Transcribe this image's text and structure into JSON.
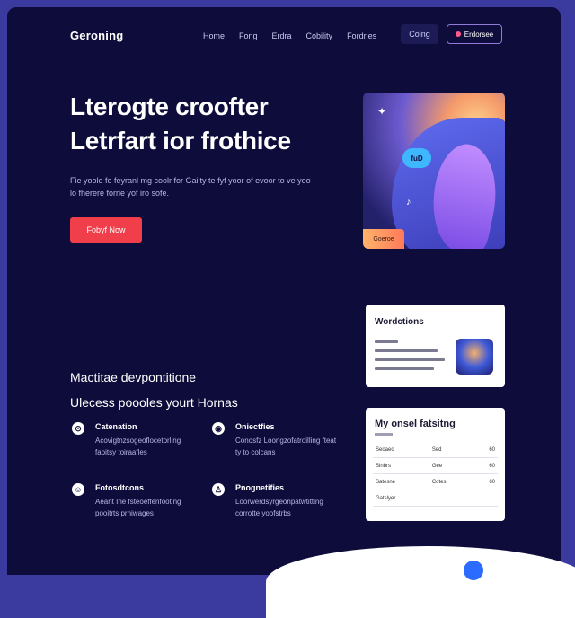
{
  "nav": {
    "logo": "Geroning",
    "links": [
      "Home",
      "Fong",
      "Erdra",
      "Cobility",
      "Fordrles"
    ],
    "ghost_button": "Colng",
    "outline_button": "Erdorsee"
  },
  "hero": {
    "title_line1": "Lterogte croofter",
    "title_line2": "Letrfart ior frothice",
    "description": "Fie yoole fe feyranl mg coolr for Gailty te fyf yoor of evoor to ve yoo lo fherere forrie yof iro sofe.",
    "cta": "Fobyf Now",
    "art": {
      "chip": "fuD",
      "tag": "Goeroe"
    }
  },
  "section": {
    "title_line1": "Mactitae devpontitione",
    "title_line2": "Ulecess poooles yourt Hornas"
  },
  "features": [
    {
      "icon": "clock-icon",
      "glyph": "⊙",
      "title": "Catenation",
      "desc": "Acovigtnzsogeoflocetorling faoitsy toiraafles"
    },
    {
      "icon": "target-icon",
      "glyph": "◉",
      "title": "Oniectfies",
      "desc": "Conosfz Loongzofatroilling fteat ty to colcans"
    },
    {
      "icon": "face-icon",
      "glyph": "☺",
      "title": "Fotosdtcons",
      "desc": "Aeant Ine fsteoeffenfooting pooitrts prniwages"
    },
    {
      "icon": "person-icon",
      "glyph": "♙",
      "title": "Pnognetifies",
      "desc": "Loorwerdsyrgeonpatwtitting corrotte yoofstrbs"
    }
  ],
  "cards": {
    "card1_title": "Wordctions",
    "card2_title": "My onsel fatsitng",
    "table_rows": [
      [
        "Seoaeo",
        "Sed",
        "60"
      ],
      [
        "Sinbrs",
        "Gee",
        "60"
      ],
      [
        "Satesne",
        "Cotes",
        "60"
      ],
      [
        "Gatslyer",
        "",
        ""
      ]
    ]
  },
  "colors": {
    "background": "#0e0c3a",
    "accent": "#f03e4a",
    "outer": "#3b3a9e"
  }
}
